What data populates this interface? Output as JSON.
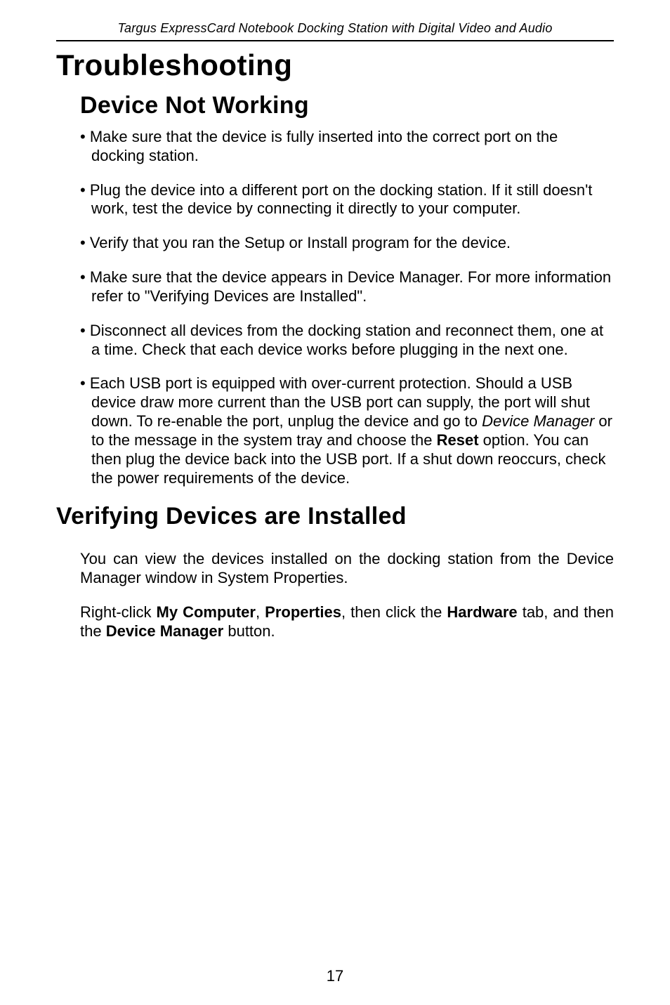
{
  "header": {
    "running_title": "Targus ExpressCard Notebook Docking Station with Digital Video and Audio"
  },
  "sections": {
    "title": "Troubleshooting",
    "device_not_working": {
      "heading": "Device Not Working",
      "bullets": {
        "b1": "Make sure that the device is fully inserted into the correct port on the docking station.",
        "b2": "Plug the device into a different port on the docking station. If it still doesn't work, test the device by connecting it directly to your computer.",
        "b3": "Verify that you ran the Setup or Install program for the device.",
        "b4": "Make sure that the device appears in Device Manager. For more information refer to \"Verifying Devices are Installed\".",
        "b5": "Disconnect all devices from the docking station and reconnect them, one at a time. Check that each device works before plugging in the next one.",
        "b6_pre": "Each USB port is equipped with over-current protection. Should a USB device draw more current than the USB port can supply, the port will shut down. To re-enable the port, unplug the device and go to ",
        "b6_em": "Device Manager",
        "b6_mid": " or to the message in the system tray and choose the ",
        "b6_bold": "Reset",
        "b6_post": " option. You can then plug the device back into the USB port. If a shut down reoccurs, check the power requirements of the device."
      }
    },
    "verifying": {
      "heading": "Verifying Devices are Installed",
      "p1": "You can view the devices installed on the docking station from the Device Manager window in System Properties.",
      "p2_pre": "Right-click ",
      "p2_b1": "My Computer",
      "p2_sep1": ", ",
      "p2_b2": "Properties",
      "p2_mid": ", then click the ",
      "p2_b3": "Hardware",
      "p2_mid2": " tab, and then the ",
      "p2_b4": "Device Manager",
      "p2_post": " button."
    }
  },
  "footer": {
    "page_number": "17"
  }
}
